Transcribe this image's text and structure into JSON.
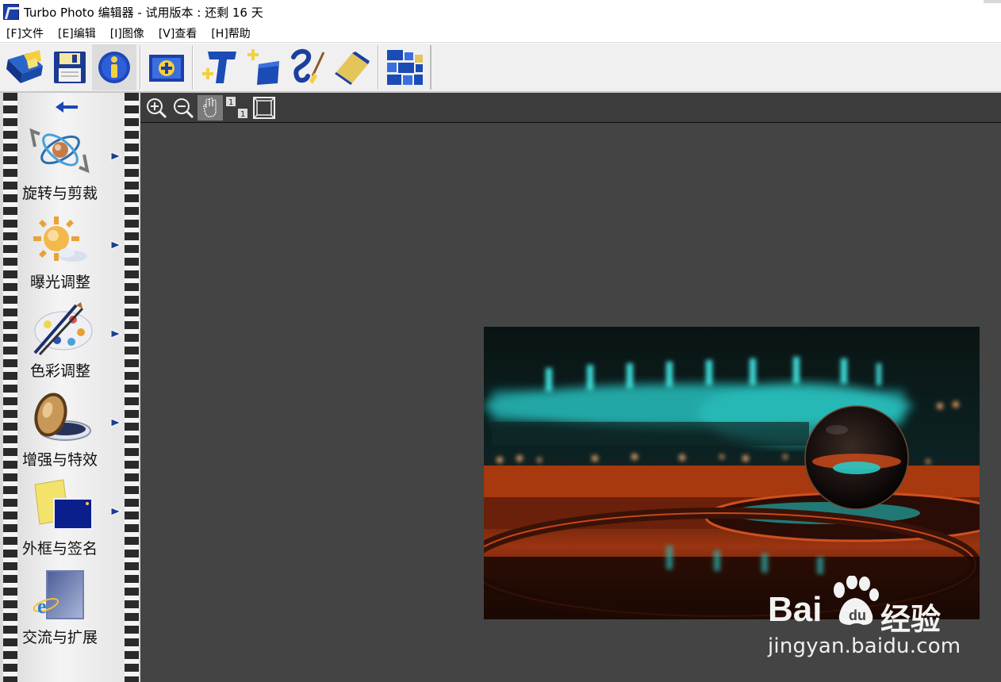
{
  "window": {
    "title": "Turbo Photo 编辑器  - 试用版本 : 还剩 16 天"
  },
  "menu": [
    {
      "label": "[F]文件"
    },
    {
      "label": "[E]编辑"
    },
    {
      "label": "[I]图像"
    },
    {
      "label": "[V]查看"
    },
    {
      "label": "[H]帮助"
    }
  ],
  "toolbar": {
    "buttons": [
      {
        "icon": "open-folder-icon"
      },
      {
        "icon": "save-disk-icon"
      },
      {
        "icon": "info-icon"
      },
      {
        "icon": "add-photo-icon"
      },
      {
        "icon": "add-text-icon"
      },
      {
        "icon": "add-layer-icon"
      },
      {
        "icon": "brush-icon"
      },
      {
        "icon": "eraser-icon"
      },
      {
        "icon": "batch-icon"
      }
    ]
  },
  "viewbar": {
    "buttons": [
      {
        "icon": "zoom-in-icon"
      },
      {
        "icon": "zoom-out-icon"
      },
      {
        "icon": "hand-pan-icon",
        "selected": true
      },
      {
        "icon": "actual-size-icon"
      },
      {
        "icon": "fit-window-icon"
      }
    ]
  },
  "sidebar": {
    "items": [
      {
        "label": "旋转与剪裁",
        "icon": "rotate-crop-icon",
        "has_submenu": true
      },
      {
        "label": "曝光调整",
        "icon": "exposure-icon",
        "has_submenu": true
      },
      {
        "label": "色彩调整",
        "icon": "color-palette-icon",
        "has_submenu": true
      },
      {
        "label": "增强与特效",
        "icon": "effects-lens-icon",
        "has_submenu": true
      },
      {
        "label": "外框与签名",
        "icon": "frame-signature-icon",
        "has_submenu": true
      },
      {
        "label": "交流与扩展",
        "icon": "share-ie-icon",
        "has_submenu": false
      }
    ]
  },
  "watermark": {
    "brand_latin": "Bai",
    "brand_cn": "经验",
    "url": "jingyan.baidu.com"
  },
  "colors": {
    "workarea_bg": "#444444",
    "toolbar_bg": "#f0f0f0",
    "accent_blue": "#1c3fa8"
  }
}
